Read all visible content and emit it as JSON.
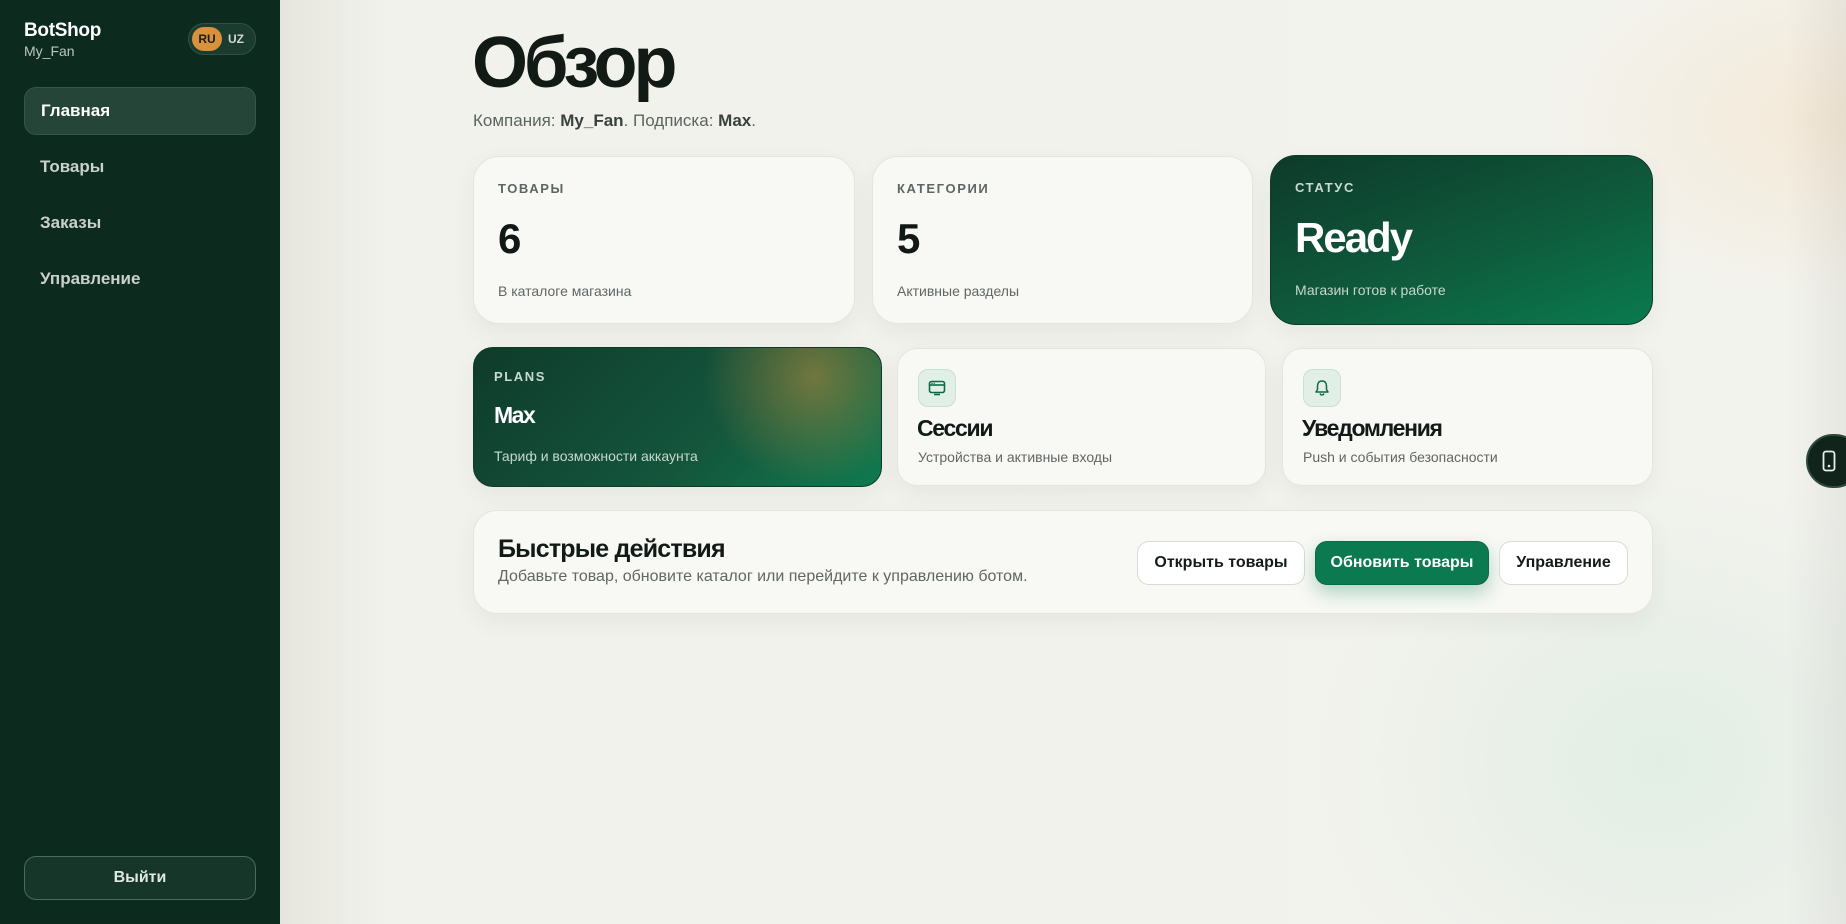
{
  "sidebar": {
    "brand_name": "BotShop",
    "brand_sub": "My_Fan",
    "languages": [
      "RU",
      "UZ"
    ],
    "active_language": "RU",
    "items": [
      {
        "label": "Главная",
        "active": true
      },
      {
        "label": "Товары"
      },
      {
        "label": "Заказы"
      },
      {
        "label": "Управление"
      }
    ],
    "logout_label": "Выйти"
  },
  "header": {
    "title": "Обзор",
    "company_label": "Компания:",
    "company": "My_Fan",
    "subscription_label": ". Подписка:",
    "subscription": "Max",
    "end": "."
  },
  "stats": [
    {
      "label": "ТОВАРЫ",
      "value": "6",
      "desc": "В каталоге магазина"
    },
    {
      "label": "КАТЕГОРИИ",
      "value": "5",
      "desc": "Активные разделы"
    },
    {
      "label": "СТАТУС",
      "value": "Ready",
      "desc": "Магазин готов к работе"
    }
  ],
  "plans": {
    "label": "PLANS",
    "value": "Max",
    "desc": "Тариф и возможности аккаунта"
  },
  "sessions": {
    "icon": "browser-window-icon",
    "title": "Сессии",
    "desc": "Устройства и активные входы"
  },
  "notifications": {
    "icon": "bell-icon",
    "title": "Уведомления",
    "desc": "Push и события безопасности"
  },
  "quick_actions": {
    "title": "Быстрые действия",
    "desc": "Добавьте товар, обновите каталог или перейдите к управлению ботом.",
    "buttons": [
      "Открыть товары",
      "Обновить товары",
      "Управление"
    ]
  },
  "colors": {
    "sidebar_bg": "#0d2a1f",
    "accent_green": "#0c7a50",
    "lang_active": "#d8913c"
  }
}
